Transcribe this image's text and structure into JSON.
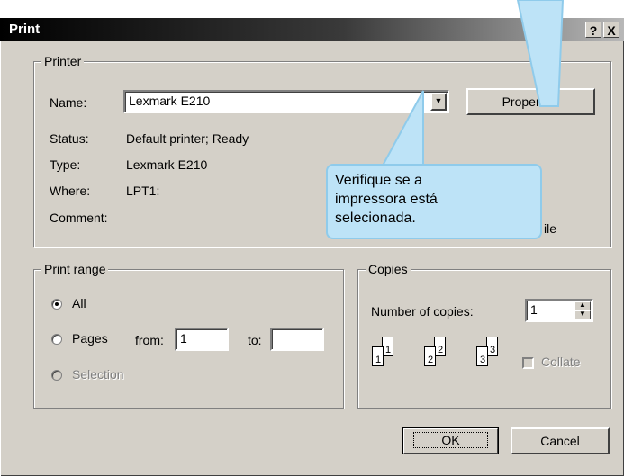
{
  "window": {
    "title": "Print",
    "help_btn": "?",
    "close_btn": "X"
  },
  "printer": {
    "group_label": "Printer",
    "name_label": "Name:",
    "name_value": "Lexmark E210",
    "properties_btn": "Properties",
    "status_label": "Status:",
    "status_value": "Default printer; Ready",
    "type_label": "Type:",
    "type_value": "Lexmark E210",
    "where_label": "Where:",
    "where_value": "LPT1:",
    "comment_label": "Comment:",
    "print_to_file_partial": "ile"
  },
  "print_range": {
    "group_label": "Print range",
    "all_label": "All",
    "pages_label": "Pages",
    "from_label": "from:",
    "from_value": "1",
    "to_label": "to:",
    "to_value": "",
    "selection_label": "Selection",
    "selected": "All"
  },
  "copies": {
    "group_label": "Copies",
    "number_label": "Number of copies:",
    "number_value": "1",
    "collate_label": "Collate",
    "collate_checked": false,
    "collate_icon": [
      "1",
      "1",
      "2",
      "2",
      "3",
      "3"
    ]
  },
  "buttons": {
    "ok": "OK",
    "cancel": "Cancel"
  },
  "callout": {
    "lines": [
      "Verifique se a",
      "impressora está",
      "selecionada."
    ],
    "fill": "#bde3f7",
    "stroke": "#8fcbeb"
  }
}
